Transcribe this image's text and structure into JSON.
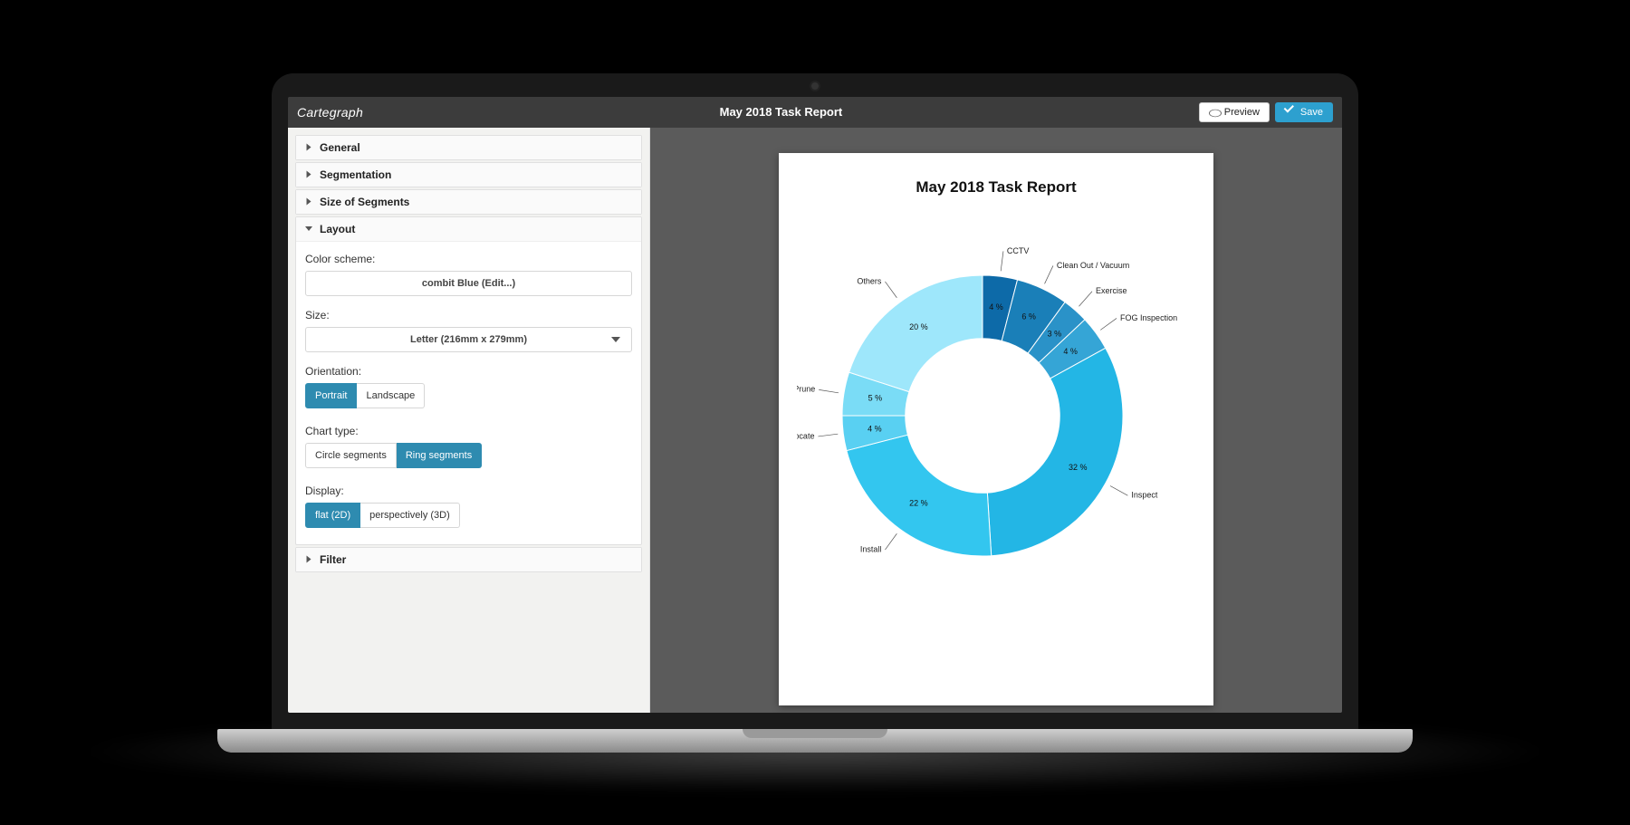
{
  "brand": "Cartegraph",
  "header": {
    "title": "May 2018 Task Report",
    "preview_label": "Preview",
    "save_label": "Save"
  },
  "sidebar": {
    "sections": {
      "general": {
        "label": "General"
      },
      "segmentation": {
        "label": "Segmentation"
      },
      "size_of_segments": {
        "label": "Size of Segments"
      },
      "layout": {
        "label": "Layout"
      },
      "filter": {
        "label": "Filter"
      }
    },
    "layout_panel": {
      "color_scheme_label": "Color scheme:",
      "color_scheme_value": "combit Blue (Edit...)",
      "size_label": "Size:",
      "size_value": "Letter (216mm x 279mm)",
      "orientation_label": "Orientation:",
      "orientation_options": [
        "Portrait",
        "Landscape"
      ],
      "orientation_selected": "Portrait",
      "chart_type_label": "Chart type:",
      "chart_type_options": [
        "Circle segments",
        "Ring segments"
      ],
      "chart_type_selected": "Ring segments",
      "display_label": "Display:",
      "display_options": [
        "flat (2D)",
        "perspectively (3D)"
      ],
      "display_selected": "flat (2D)"
    }
  },
  "report": {
    "title": "May 2018 Task Report"
  },
  "chart_data": {
    "type": "pie",
    "variant": "donut",
    "inner_radius_ratio": 0.55,
    "title": "May 2018 Task Report",
    "series": [
      {
        "name": "CCTV",
        "value": 4,
        "percent_label": "4 %",
        "color": "#0d6aa8"
      },
      {
        "name": "Clean Out / Vacuum",
        "value": 6,
        "percent_label": "6 %",
        "color": "#1a7fb8"
      },
      {
        "name": "Exercise",
        "value": 3,
        "percent_label": "3 %",
        "color": "#2a92c8"
      },
      {
        "name": "FOG Inspection",
        "value": 4,
        "percent_label": "4 %",
        "color": "#35a5d6"
      },
      {
        "name": "Inspect",
        "value": 32,
        "percent_label": "32 %",
        "color": "#23b6e5"
      },
      {
        "name": "Install",
        "value": 22,
        "percent_label": "22 %",
        "color": "#33c6ef"
      },
      {
        "name": "Locate",
        "value": 4,
        "percent_label": "4 %",
        "color": "#59d0f2"
      },
      {
        "name": "Prune",
        "value": 5,
        "percent_label": "5 %",
        "color": "#7adcf6"
      },
      {
        "name": "Others",
        "value": 20,
        "percent_label": "20 %",
        "color": "#9ee7fb"
      }
    ]
  }
}
